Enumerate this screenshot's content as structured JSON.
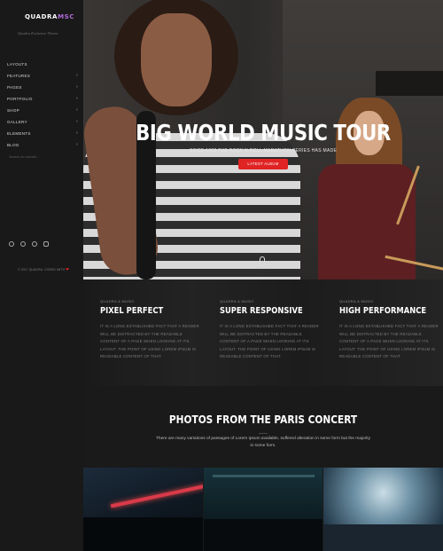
{
  "brand": {
    "logo_main": "QUADRA",
    "logo_accent": "MSC",
    "tagline": "Quadra Exclusive Theme"
  },
  "nav": [
    {
      "label": "LAYOUTS",
      "has_submenu": false
    },
    {
      "label": "FEATURES",
      "has_submenu": true
    },
    {
      "label": "PAGES",
      "has_submenu": true
    },
    {
      "label": "PORTFOLIO",
      "has_submenu": true
    },
    {
      "label": "SHOP",
      "has_submenu": true
    },
    {
      "label": "GALLERY",
      "has_submenu": true
    },
    {
      "label": "ELEMENTS",
      "has_submenu": true
    },
    {
      "label": "BLOG",
      "has_submenu": true
    }
  ],
  "search": {
    "placeholder": "Search on website..."
  },
  "socials": [
    "twitter-icon",
    "dribbble-icon",
    "instagram-icon",
    "skype-icon"
  ],
  "footer": {
    "copyright": "© 2017 QUADRA. CODED WITH",
    "heart": "❤"
  },
  "hero": {
    "title": "BIG WORLD MUSIC TOUR",
    "subtitle": "SINCE 1998 THE ROCK N ROLL MARATHON SERIES HAS MADE",
    "button_label": "LATEST ALBUM"
  },
  "features": [
    {
      "kicker": "QUADRA & MUSIC",
      "title": "PIXEL PERFECT",
      "text": "IT IS A LONG ESTABLISHED FACT THAT A READER WILL BE DISTRACTED BY THE READABLE CONTENT OF A PAGE WHEN LOOKING AT ITS LAYOUT. THE POINT OF USING LOREM IPSUM IS READABLE CONTENT OF THAT."
    },
    {
      "kicker": "QUADRA & MUSIC",
      "title": "SUPER RESPONSIVE",
      "text": "IT IS A LONG ESTABLISHED FACT THAT A READER WILL BE DISTRACTED BY THE READABLE CONTENT OF A PAGE WHEN LOOKING AT ITS LAYOUT. THE POINT OF USING LOREM IPSUM IS READABLE CONTENT OF THAT."
    },
    {
      "kicker": "QUADRA & MUSIC",
      "title": "HIGH PERFORMANCE",
      "text": "IT IS A LONG ESTABLISHED FACT THAT A READER WILL BE DISTRACTED BY THE READABLE CONTENT OF A PAGE WHEN LOOKING AT ITS LAYOUT. THE POINT OF USING LOREM IPSUM IS READABLE CONTENT OF THAT."
    }
  ],
  "photos": {
    "title": "PHOTOS FROM THE PARIS CONCERT",
    "description": "There are many variations of passages of Lorem Ipsum available, suffered alteration in some form but the majority in some form."
  },
  "colors": {
    "accent": "#e02424",
    "logo_accent": "#b06bd9",
    "sidebar_bg": "#191919"
  }
}
